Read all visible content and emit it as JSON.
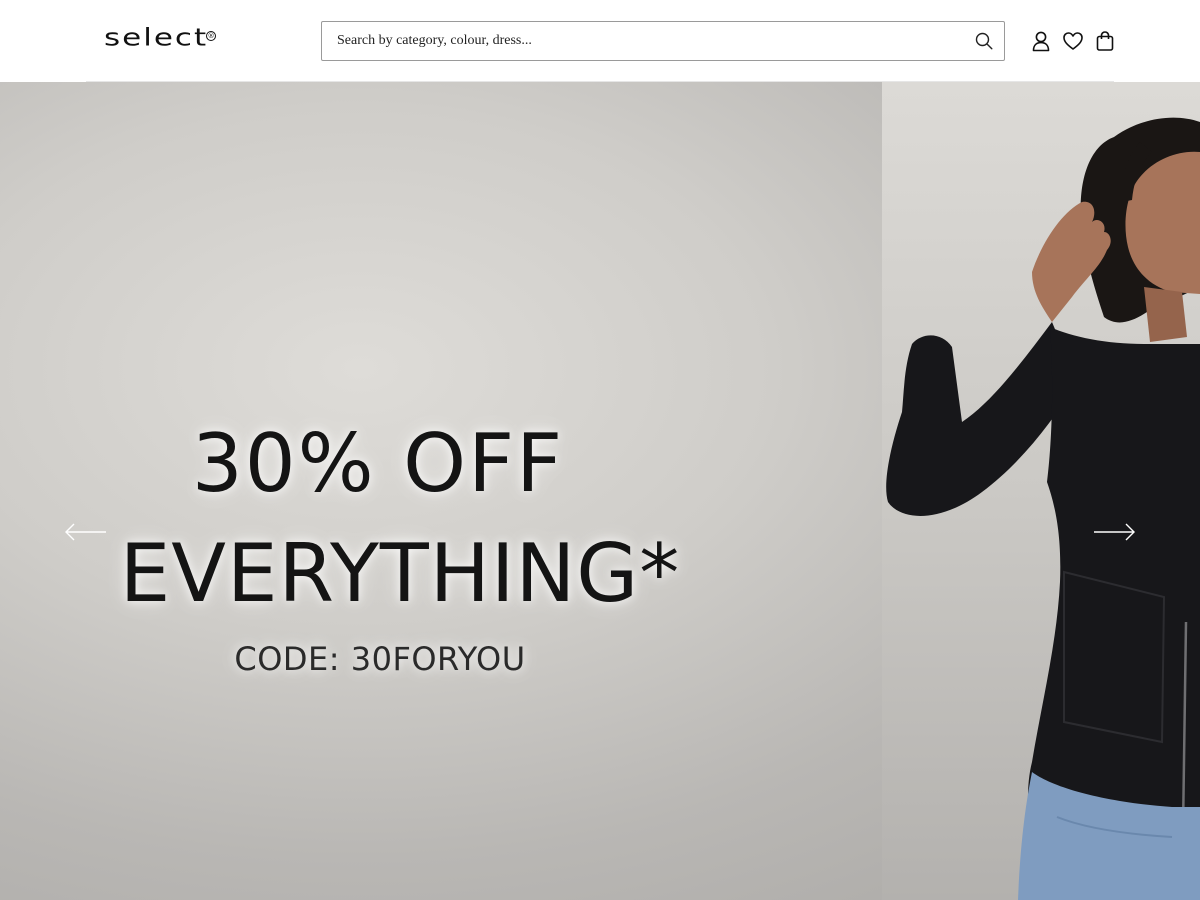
{
  "header": {
    "logo": "select",
    "logo_mark": "®",
    "search": {
      "placeholder": "Search by category, colour, dress..."
    },
    "icons": [
      "search-icon",
      "account-icon",
      "wishlist-icon",
      "bag-icon"
    ]
  },
  "hero": {
    "headline_line1": "30% OFF",
    "headline_line2": "EVERYTHING*",
    "promo_code": "CODE: 30FORYOU",
    "prev_icon": "arrow-left-icon",
    "next_icon": "arrow-right-icon"
  },
  "colors": {
    "text": "#111111",
    "background": "#ffffff",
    "hero_background": "#cfcdc9",
    "jacket": "#17171a",
    "denim": "#7f9cc0"
  }
}
